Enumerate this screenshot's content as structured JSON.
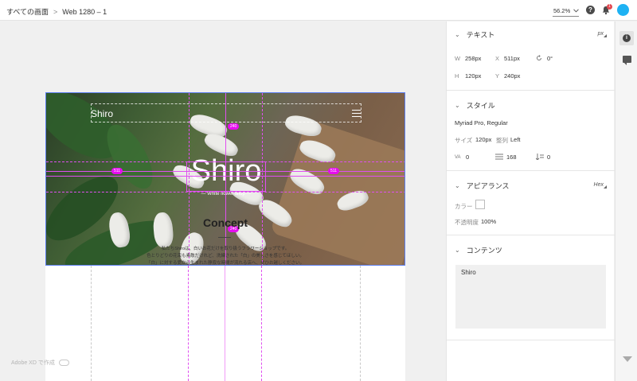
{
  "topbar": {
    "breadcrumb_root": "すべての画面",
    "breadcrumb_sep": ">",
    "breadcrumb_current": "Web 1280 – 1",
    "zoom": "56.2%",
    "help": "?",
    "notification_count": "1"
  },
  "artboard": {
    "logo": "Shiro",
    "title": "Shiro",
    "subtitle": "— White flower shop —",
    "concept_heading": "Concept",
    "concept_lines": [
      "私たちShiroは、白いお花だけを取り扱うフラワーショップです。",
      "色とりどりの花束も素敵だけれど、洗練された「白」の美しさを感じてほしい。",
      "「白」に対する愛から生まれた静寂な時間が流れる店へ、ぜひお越しください。"
    ],
    "guide_labels": {
      "top": "240",
      "left": "511",
      "right": "511",
      "bottom": "240"
    }
  },
  "footer_badge": "Adobe XD で作成",
  "panel": {
    "text_section": {
      "title": "テキスト",
      "unit": "px",
      "w_label": "W",
      "w_value": "258px",
      "x_label": "X",
      "x_value": "511px",
      "rotate_value": "0°",
      "h_label": "H",
      "h_value": "120px",
      "y_label": "Y",
      "y_value": "240px"
    },
    "style_section": {
      "title": "スタイル",
      "font": "Myriad Pro, Regular",
      "size_label": "サイズ",
      "size_value": "120px",
      "align_label": "整列",
      "align_value": "Left",
      "char_spacing": "0",
      "line_spacing": "168",
      "para_spacing": "0"
    },
    "appearance_section": {
      "title": "アピアランス",
      "mode": "Hex",
      "color_label": "カラー",
      "color_value": "#FFFFFF",
      "opacity_label": "不透明度",
      "opacity_value": "100%"
    },
    "content_section": {
      "title": "コンテンツ",
      "text": "Shiro"
    }
  },
  "strip": {
    "info": "i"
  }
}
